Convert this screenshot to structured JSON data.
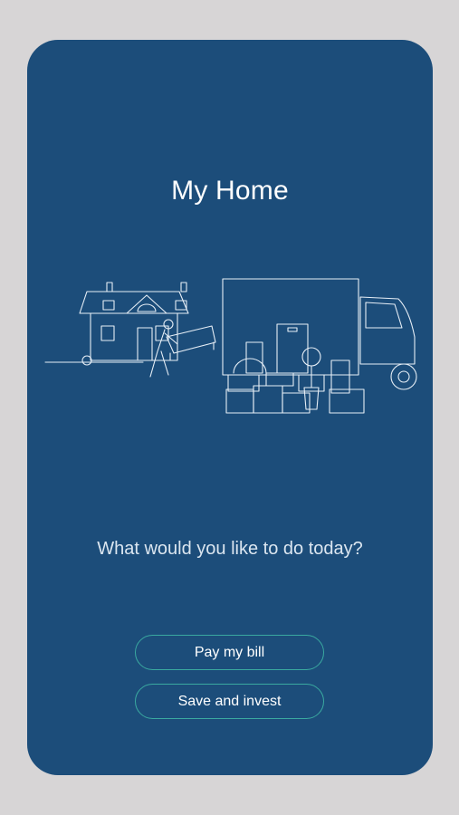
{
  "header": {
    "title": "My Home"
  },
  "illustration": {
    "name": "moving-house-illustration"
  },
  "prompt": {
    "text": "What would you like to do today?"
  },
  "actions": [
    {
      "label": "Pay my bill"
    },
    {
      "label": "Save and invest"
    }
  ],
  "colors": {
    "background": "#d7d5d6",
    "card": "#1c4d7a",
    "button_border": "#3aa9a0",
    "text": "#ffffff"
  }
}
